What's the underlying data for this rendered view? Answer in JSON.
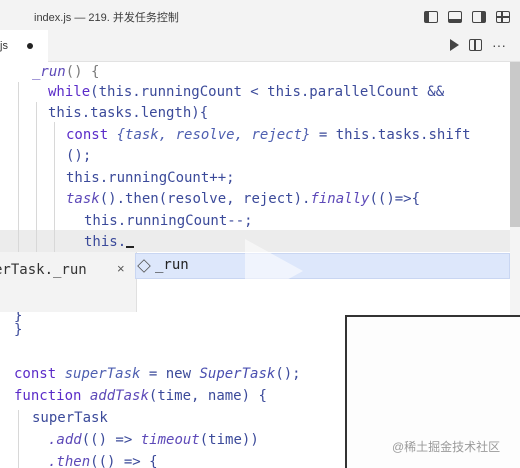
{
  "window": {
    "title": "index.js — 219. 并发任务控制"
  },
  "tab": {
    "label": "js"
  },
  "code": {
    "l1": "_run",
    "l2_while": "while",
    "l2_rest": "(this.runningCount < this.parallelCount &&",
    "l3": "this.tasks.length){",
    "l4_const": "const",
    "l4_obj": "{task, resolve, reject}",
    "l4_rest": " = this.tasks.shift",
    "l5": "();",
    "l6": "this.runningCount++;",
    "l7_task": "task",
    "l7_then": "().then",
    "l7_args": "(resolve, reject).",
    "l7_finally": "finally",
    "l7_end": "(()=>{",
    "l8": "this.runningCount--;",
    "l9": "this.",
    "l10": "}",
    "l11": "}",
    "l12_const": "const",
    "l12_var": "superTask",
    "l12_new": " = new ",
    "l12_class": "SuperTask",
    "l12_end": "();",
    "l13_fn": "function",
    "l13_name": "addTask",
    "l13_end": "(time, name) {",
    "l14": "superTask",
    "l15_add": ".add",
    "l15_mid": "(() => ",
    "l15_timeout": "timeout",
    "l15_end": "(time))",
    "l16_then": ".then",
    "l16_end": "(() => {"
  },
  "hint": {
    "text": "erTask._run",
    "close": "×"
  },
  "suggestion": {
    "label": "_run",
    "icon": "method-cube-icon"
  },
  "watermark": "@稀土掘金技术社区"
}
